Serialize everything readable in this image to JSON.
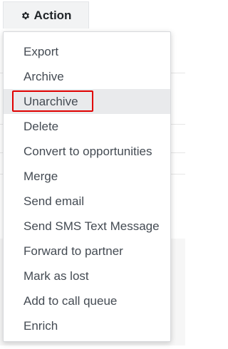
{
  "toolbar": {
    "action_label": "Action",
    "action_icon": "gear-icon"
  },
  "menu": {
    "items": [
      {
        "label": "Export"
      },
      {
        "label": "Archive"
      },
      {
        "label": "Unarchive",
        "highlighted": true
      },
      {
        "label": "Delete"
      },
      {
        "label": "Convert to opportunities"
      },
      {
        "label": "Merge"
      },
      {
        "label": "Send email"
      },
      {
        "label": "Send SMS Text Message"
      },
      {
        "label": "Forward to partner"
      },
      {
        "label": "Mark as lost"
      },
      {
        "label": "Add to call queue"
      },
      {
        "label": "Enrich"
      }
    ]
  },
  "colors": {
    "highlight_border": "#e00000",
    "active_row": "#e9eaec",
    "button_bg": "#f2f3f4"
  }
}
